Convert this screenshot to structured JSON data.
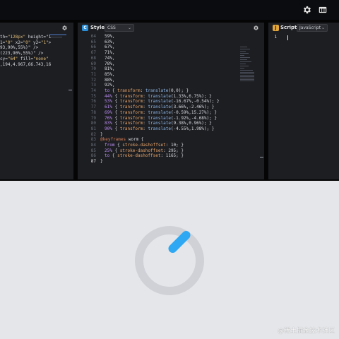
{
  "html_panel": {
    "lines": [
      {
        "text": "th=\"128px\" height=\"1"
      },
      {
        "text": ""
      },
      {
        "text": ""
      },
      {
        "text": ""
      },
      {
        "text": ""
      },
      {
        "text": "1=\"0\" x2=\"0\" y2=\"1\">"
      },
      {
        "text": "93,90%,55%)\" />"
      },
      {
        "text": "(223,90%,55%)\" />"
      },
      {
        "text": ""
      },
      {
        "text": ""
      },
      {
        "text": "cy=\"64\" fill=\"none\""
      },
      {
        "text": ",194,4.967,66.743,16"
      }
    ]
  },
  "style_panel": {
    "badge": "C",
    "title": "Style",
    "language": "CSS",
    "lines": [
      {
        "n": "64",
        "text": "59%,"
      },
      {
        "n": "65",
        "text": "63%,"
      },
      {
        "n": "66",
        "text": "67%,"
      },
      {
        "n": "67",
        "text": "71%,"
      },
      {
        "n": "68",
        "text": "74%,"
      },
      {
        "n": "69",
        "text": "78%,"
      },
      {
        "n": "70",
        "text": "81%,"
      },
      {
        "n": "71",
        "text": "85%,"
      },
      {
        "n": "72",
        "text": "88%,"
      },
      {
        "n": "73",
        "text": "92%,"
      },
      {
        "n": "74",
        "text": "to { transform: translate(0,0); }"
      },
      {
        "n": "75",
        "text": "44% { transform: translate(1.33%,6.75%); }"
      },
      {
        "n": "76",
        "text": "53% { transform: translate(-16.67%,-0.54%); }"
      },
      {
        "n": "77",
        "text": "61% { transform: translate(3.66%,-2.46%); }"
      },
      {
        "n": "78",
        "text": "69% { transform: translate(-0.59%,15.27%); }"
      },
      {
        "n": "79",
        "text": "76% { transform: translate(-1.92%,-4.68%); }"
      },
      {
        "n": "80",
        "text": "83% { transform: translate(9.38%,0.96%); }"
      },
      {
        "n": "81",
        "text": "90% { transform: translate(-4.55%,1.98%); }"
      },
      {
        "n": "82",
        "text": "}"
      },
      {
        "n": "83",
        "text": "@keyframes worm {"
      },
      {
        "n": "84",
        "text": "from { stroke-dashoffset: 10; }"
      },
      {
        "n": "85",
        "text": "25% { stroke-dashoffset: 295; }"
      },
      {
        "n": "86",
        "text": "to { stroke-dashoffset: 1165; }"
      },
      {
        "n": "87",
        "text": "}"
      }
    ]
  },
  "script_panel": {
    "badge": "J",
    "title": "Script",
    "language": "JavaScript",
    "lines": [
      {
        "n": "1",
        "text": ""
      }
    ]
  },
  "preview": {
    "ring_color": "#cfd1d6",
    "worm_color": "#2ea8f2",
    "background": "#e4e6ea"
  },
  "watermark": "@稀土掘金技术社区",
  "icons": {
    "top_settings": "settings-icon",
    "top_layout": "layout-icon",
    "panel_settings": "gear-icon"
  }
}
